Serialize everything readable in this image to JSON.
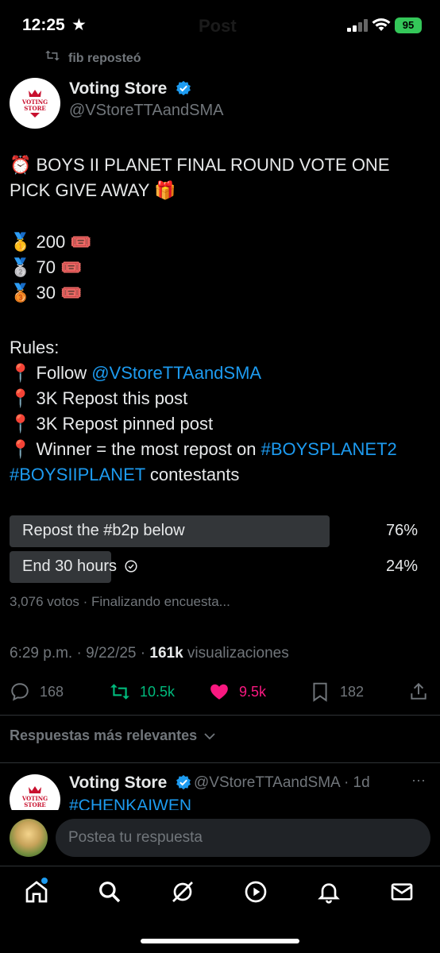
{
  "status_bar": {
    "time": "12:25",
    "battery": "95",
    "ghost_title": "Post"
  },
  "repost_banner": {
    "text": "fib reposteó"
  },
  "post": {
    "author_name": "Voting Store",
    "author_handle": "@VStoreTTAandSMA",
    "avatar_text": "VOTING STORE",
    "headline_line1": "⏰ BOYS II PLANET FINAL ROUND VOTE ONE",
    "headline_line2": "PICK GIVE AWAY 🎁",
    "prizes": [
      {
        "medal": "🥇",
        "amount": "200",
        "ticket": "🎟️"
      },
      {
        "medal": "🥈",
        "amount": "70",
        "ticket": "🎟️"
      },
      {
        "medal": "🥉",
        "amount": "30",
        "ticket": "🎟️"
      }
    ],
    "rules_title": "Rules:",
    "rules": {
      "r1_prefix": "📍 Follow ",
      "r1_link": "@VStoreTTAandSMA",
      "r2": "📍 3K Repost this post",
      "r3": "📍 3K Repost pinned post",
      "r4_prefix": "📍 Winner = the most repost on ",
      "r4_link": "#BOYSPLANET2",
      "r5_link": "#BOYSIIPLANET",
      "r5_suffix": " contestants"
    }
  },
  "poll": {
    "options": [
      {
        "label": "Repost the #b2p below",
        "percent": "76%",
        "fraction": 0.76
      },
      {
        "label": "End 30 hours",
        "percent": "24%",
        "fraction": 0.24
      }
    ],
    "summary": "3,076 votos · Finalizando encuesta..."
  },
  "meta": {
    "time": "6:29 p.m. · 9/22/25 · ",
    "views": "161k",
    "views_label": " visualizaciones"
  },
  "actions": {
    "replies": "168",
    "reposts": "10.5k",
    "likes": "9.5k",
    "bookmarks": "182"
  },
  "colors": {
    "accent": "#1d9bf0",
    "repost": "#00ba7c",
    "like": "#f91880"
  },
  "relevant_label": "Respuestas más relevantes",
  "reply_preview": {
    "author_name": "Voting Store",
    "handle_time": "@VStoreTTAandSMA · 1d",
    "text": "#CHENKAIWEN",
    "more": "···"
  },
  "composer": {
    "placeholder": "Postea tu respuesta"
  },
  "nav": [
    "home-icon",
    "search-icon",
    "grok-icon",
    "video-icon",
    "notifications-icon",
    "messages-icon"
  ]
}
